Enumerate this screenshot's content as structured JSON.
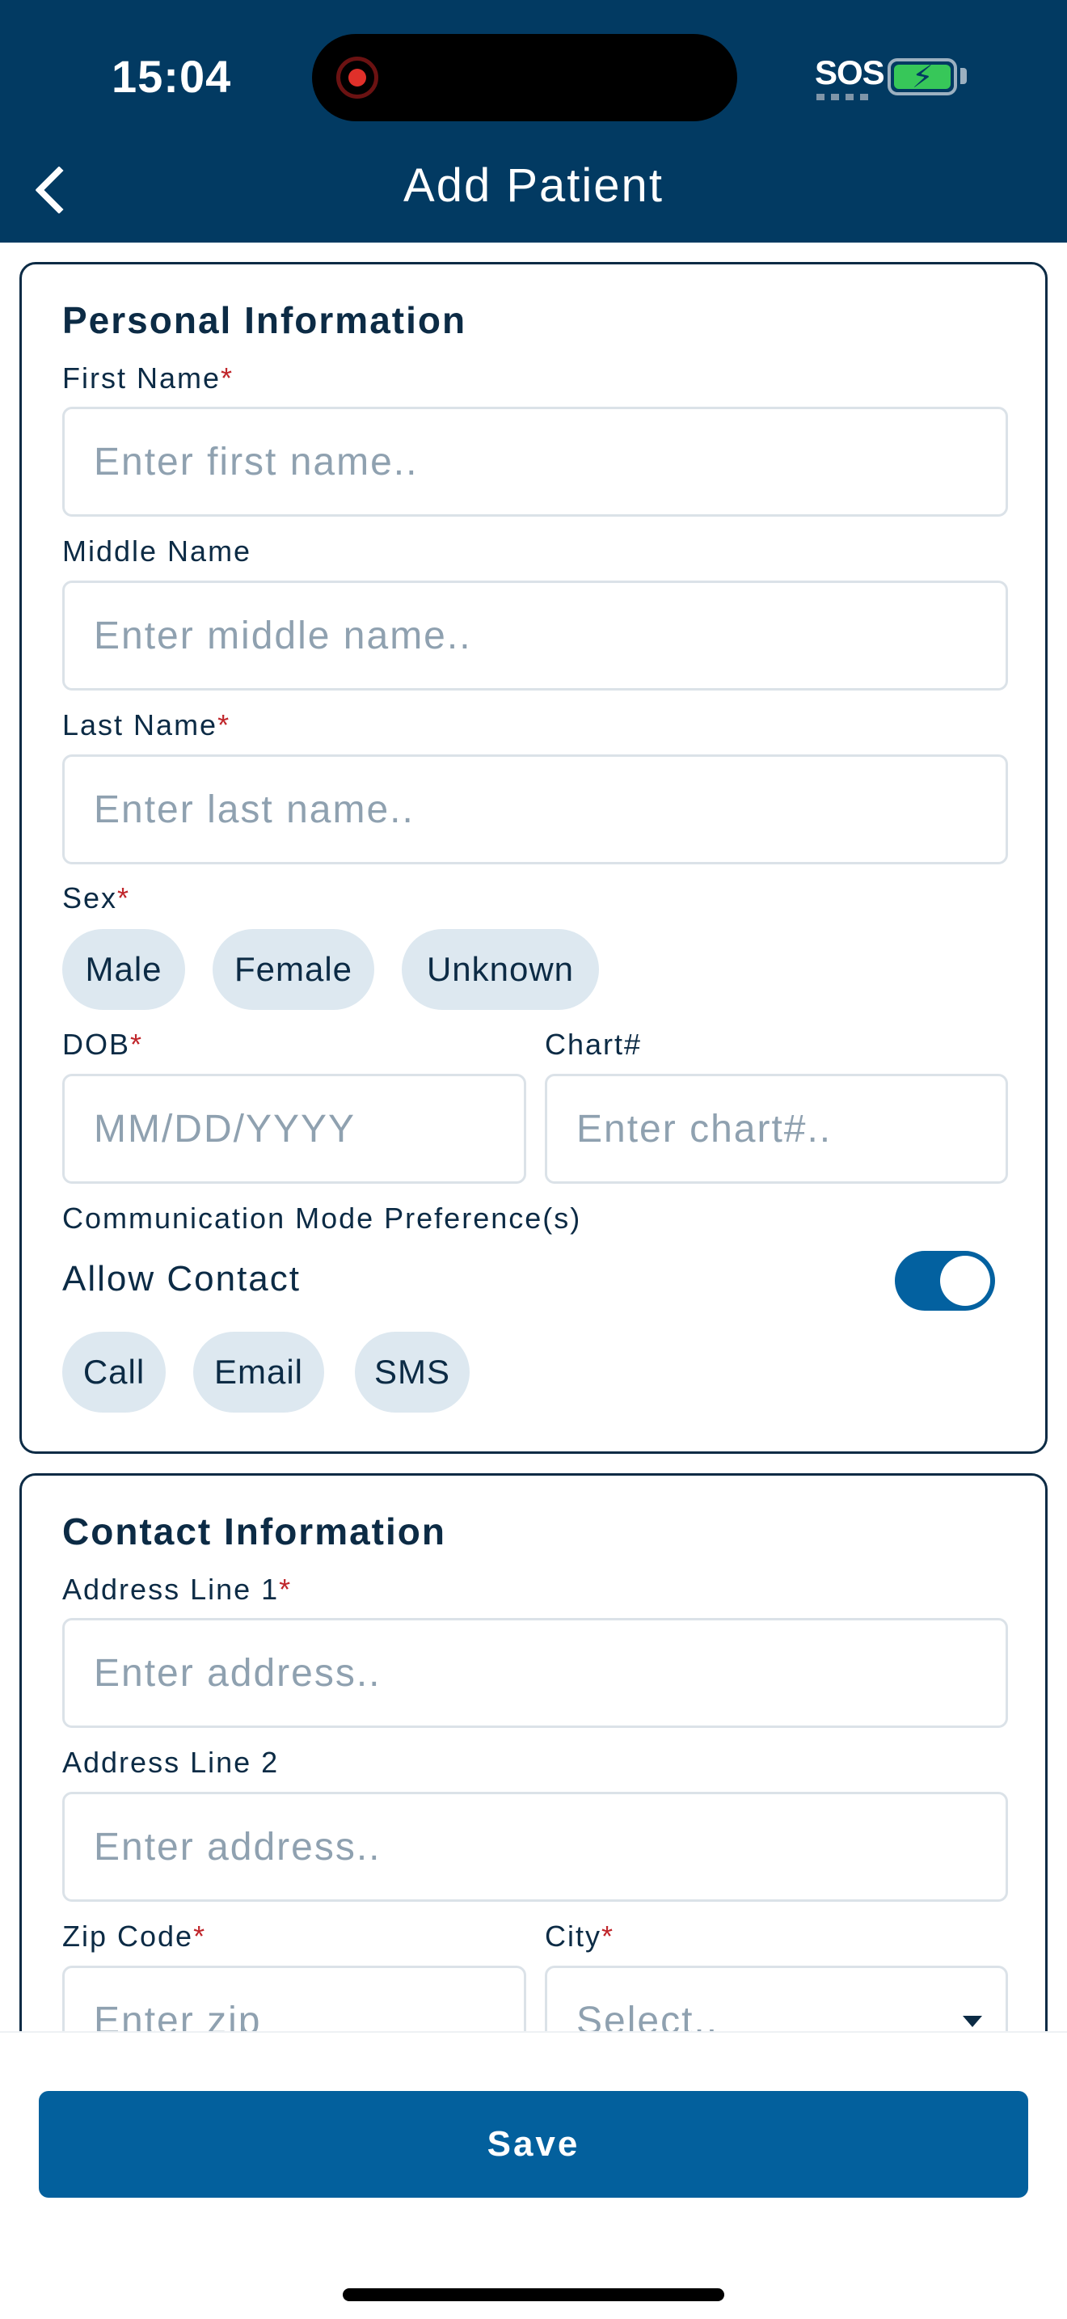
{
  "status_bar": {
    "time": "15:04",
    "sos": "SOS"
  },
  "header": {
    "title": "Add Patient"
  },
  "personal": {
    "title": "Personal Information",
    "first_name": {
      "label": "First Name",
      "required": "*",
      "placeholder": "Enter first name.."
    },
    "middle_name": {
      "label": "Middle Name",
      "placeholder": "Enter middle name.."
    },
    "last_name": {
      "label": "Last Name",
      "required": "*",
      "placeholder": "Enter last name.."
    },
    "sex": {
      "label": "Sex",
      "required": "*",
      "options": [
        "Male",
        "Female",
        "Unknown"
      ]
    },
    "dob": {
      "label": "DOB",
      "required": "*",
      "placeholder": "MM/DD/YYYY"
    },
    "chart": {
      "label": "Chart#",
      "placeholder": "Enter chart#.."
    },
    "comm_pref": {
      "label": "Communication Mode Preference(s)",
      "allow_contact_label": "Allow Contact",
      "allow_contact_on": true,
      "options": [
        "Call",
        "Email",
        "SMS"
      ]
    }
  },
  "contact": {
    "title": "Contact Information",
    "address1": {
      "label": "Address Line 1",
      "required": "*",
      "placeholder": "Enter address.."
    },
    "address2": {
      "label": "Address Line 2",
      "placeholder": "Enter address.."
    },
    "zip": {
      "label": "Zip Code",
      "required": "*",
      "placeholder": "Enter zip"
    },
    "city": {
      "label": "City",
      "required": "*",
      "placeholder": "Select.."
    }
  },
  "footer": {
    "save_label": "Save"
  },
  "colors": {
    "header_bg": "#023a62",
    "primary": "#03609d",
    "chip_bg": "#dde8f0",
    "required": "#c0262b"
  }
}
